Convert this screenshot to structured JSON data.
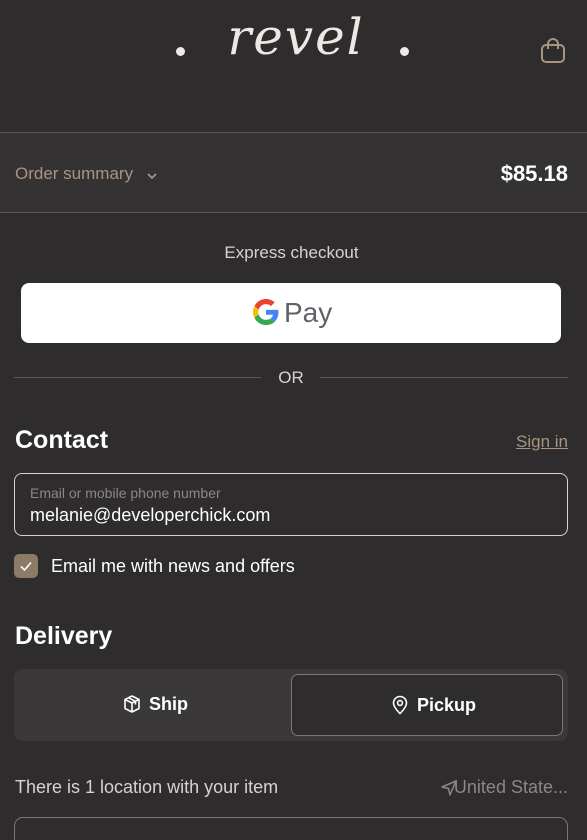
{
  "header": {
    "logo_text": "revel",
    "cart_icon": "shopping-bag-icon"
  },
  "order_summary": {
    "label": "Order summary",
    "toggle_icon": "chevron-down-icon",
    "total": "$85.18"
  },
  "express_checkout": {
    "title": "Express checkout",
    "gpay_label": "Pay",
    "gpay_icon": "google-g-icon"
  },
  "divider": {
    "text": "OR"
  },
  "contact": {
    "title": "Contact",
    "sign_in_label": "Sign in",
    "email_field": {
      "placeholder": "Email or mobile phone number",
      "value": "melanie@developerchick.com"
    },
    "newsletter": {
      "label": "Email me with news and offers",
      "checked": true
    }
  },
  "delivery": {
    "title": "Delivery",
    "options": [
      {
        "label": "Ship",
        "icon": "package-icon",
        "selected": false
      },
      {
        "label": "Pickup",
        "icon": "map-pin-icon",
        "selected": true
      }
    ],
    "location_text": "There is 1 location with your item",
    "country": "United State...",
    "country_icon": "location-arrow-icon"
  },
  "colors": {
    "background": "#2e2c2d",
    "accent": "#a9957f",
    "checkbox": "#8c7b66"
  }
}
